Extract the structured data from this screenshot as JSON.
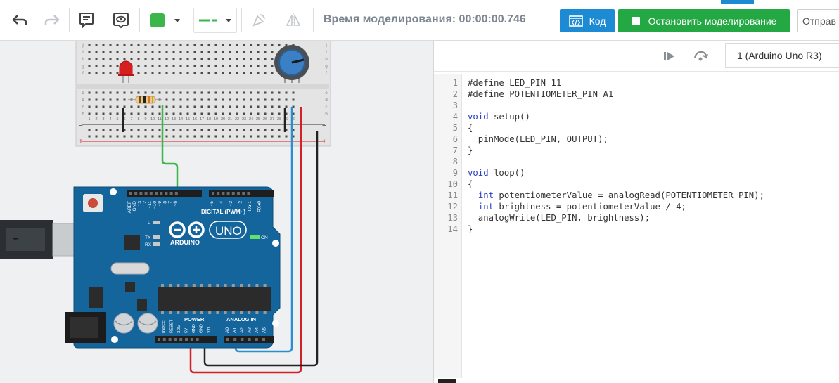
{
  "toolbar": {
    "sim_time": "Время моделирования: 00:00:00.746",
    "code_label": "Код",
    "stop_label": "Остановить моделирование",
    "send_label": "Отправ",
    "fill_color": "#3cb54a",
    "icons": [
      "undo-icon",
      "redo-icon",
      "notes-icon",
      "view-icon",
      "fill-color-icon",
      "line-style-icon",
      "rotate-icon",
      "mirror-icon",
      "code-icon"
    ]
  },
  "breadboard": {
    "top_rows": [
      "j",
      "i",
      "h",
      "g",
      "f"
    ],
    "bottom_rows": [
      "e",
      "d",
      "c",
      "b",
      "a"
    ],
    "columns": [
      "1",
      "2",
      "3",
      "4",
      "5",
      "6",
      "7",
      "8",
      "9",
      "10",
      "11",
      "12",
      "13",
      "14",
      "15",
      "16",
      "17",
      "18",
      "19",
      "20",
      "21",
      "22",
      "23",
      "24",
      "25",
      "26",
      "27",
      "28",
      "29",
      "30"
    ],
    "minus_label": "−",
    "plus_label": "+"
  },
  "arduino": {
    "brand": "ARDUINO",
    "model": "UNO",
    "digital_label": "DIGITAL (PWM~)",
    "power_label": "POWER",
    "analog_label": "ANALOG IN",
    "on_label": "ON",
    "l_label": "L",
    "tx_label": "TX",
    "rx_label": "RX",
    "digital_pins": [
      "AREF",
      "GND",
      "13",
      "12",
      "~11",
      "~10",
      "~9",
      "8",
      "7",
      "~6",
      "~5",
      "4",
      "~3",
      "2",
      "TX▸1",
      "RX◂0"
    ],
    "power_pins": [
      "IOREF",
      "RESET",
      "3.3V",
      "5V",
      "GND",
      "GND",
      "Vin"
    ],
    "analog_pins": [
      "A0",
      "A1",
      "A2",
      "A3",
      "A4",
      "A5"
    ]
  },
  "code_panel": {
    "device": "1 (Arduino Uno R3)",
    "lines": [
      {
        "n": "1",
        "text": "#define LED_PIN 11"
      },
      {
        "n": "2",
        "text": "#define POTENTIOMETER_PIN A1"
      },
      {
        "n": "3",
        "text": ""
      },
      {
        "n": "4",
        "kw": "void",
        "text": " setup()"
      },
      {
        "n": "5",
        "text": "{"
      },
      {
        "n": "6",
        "text": "  pinMode(LED_PIN, OUTPUT);"
      },
      {
        "n": "7",
        "text": "}"
      },
      {
        "n": "8",
        "text": ""
      },
      {
        "n": "9",
        "kw": "void",
        "text": " loop()"
      },
      {
        "n": "10",
        "text": "{"
      },
      {
        "n": "11",
        "indent": "  ",
        "kw": "int",
        "text": " potentiometerValue = analogRead(POTENTIOMETER_PIN);"
      },
      {
        "n": "12",
        "indent": "  ",
        "kw": "int",
        "text": " brightness = potentiometerValue / 4;"
      },
      {
        "n": "13",
        "text": "  analogWrite(LED_PIN, brightness);"
      },
      {
        "n": "14",
        "text": "}"
      }
    ]
  },
  "colors": {
    "accent_blue": "#1d8ad4",
    "stop_green": "#23a843",
    "board_blue": "#15659d",
    "wire_green": "#3cb54a",
    "wire_blue": "#2a8fd0",
    "wire_red": "#d42027",
    "wire_black": "#222222"
  }
}
